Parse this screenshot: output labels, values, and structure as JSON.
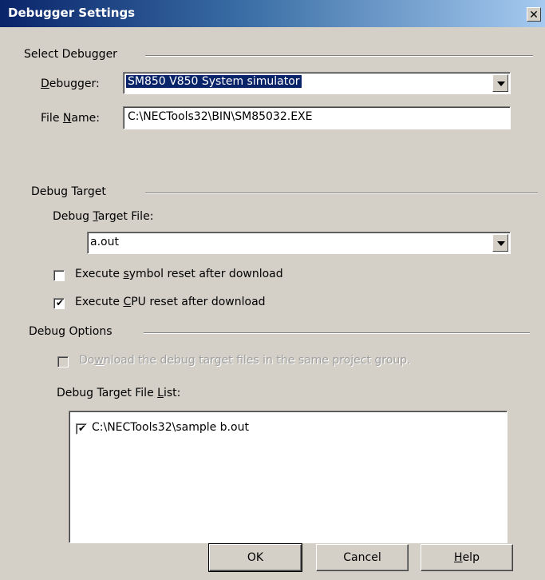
{
  "window": {
    "title": "Debugger Settings",
    "close_label": "✕"
  },
  "select_debugger": {
    "group_label": "Select Debugger",
    "debugger_label_pre": "",
    "debugger_label_u": "D",
    "debugger_label_post": "ebugger:",
    "debugger_value": "SM850 V850 System simulator",
    "filename_label_pre": "File ",
    "filename_label_u": "N",
    "filename_label_post": "ame:",
    "filename_value": "C:\\NECTools32\\BIN\\SM85032.EXE"
  },
  "debug_target": {
    "group_label": "Debug Target",
    "file_label_pre": "Debug ",
    "file_label_u": "T",
    "file_label_post": "arget File:",
    "file_value": "a.out",
    "symbol_reset_pre": "Execute ",
    "symbol_reset_u": "s",
    "symbol_reset_post": "ymbol reset after download",
    "symbol_reset_checked": false,
    "cpu_reset_pre": "Execute ",
    "cpu_reset_u": "C",
    "cpu_reset_post": "PU reset after download",
    "cpu_reset_checked": true
  },
  "debug_options": {
    "group_label": "Debug Options",
    "download_pre": "Do",
    "download_u": "w",
    "download_post": "nload the debug target files in the same project group.",
    "download_checked": false,
    "list_label_pre": "Debug Target File ",
    "list_label_u": "L",
    "list_label_post": "ist:",
    "list_items": [
      {
        "path": "C:\\NECTools32\\sample b.out",
        "checked": true
      }
    ]
  },
  "buttons": {
    "ok_label": "OK",
    "cancel_label": "Cancel",
    "help_label_u": "H",
    "help_label_post": "elp"
  }
}
